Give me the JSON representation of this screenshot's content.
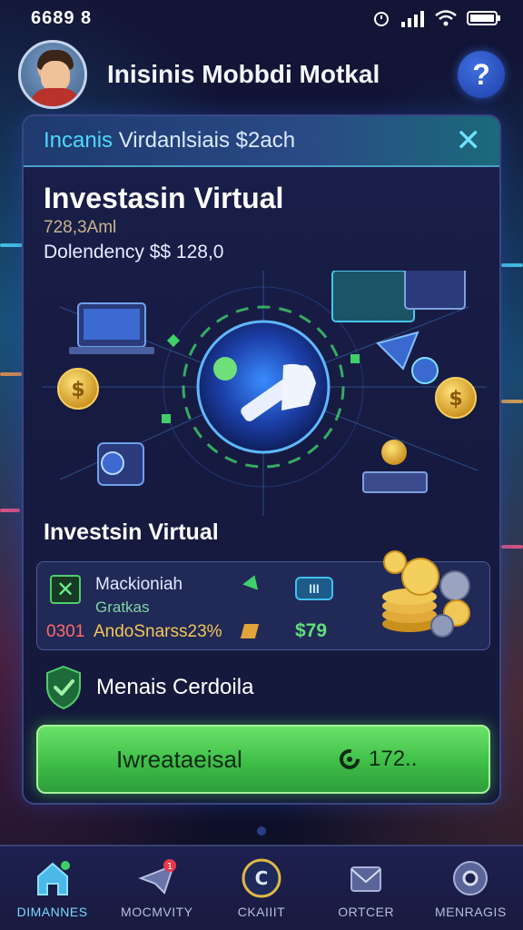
{
  "status_bar": {
    "time": "6689 8"
  },
  "header": {
    "title": "Inisinis Mobbdi Motkal",
    "help": "?"
  },
  "banner": {
    "prefix": "Incanis",
    "text": " Virdanlsiais $2ach",
    "close": "✕"
  },
  "card": {
    "title": "Investasin Virtual",
    "code": "728,3Aml",
    "dependency": "Dolendency $$ 128,0"
  },
  "section": {
    "title": "Investsin Virtual"
  },
  "stats": {
    "name": "Mackioniah",
    "sub": "Gratkas",
    "code": "0301",
    "desc": "AndoSnarss23%",
    "pill": "III",
    "amount": "$79"
  },
  "certificate": {
    "label": "Menais Cerdoila"
  },
  "invest_button": {
    "label": "Iwreataeisal",
    "amount": "172.."
  },
  "nav": {
    "items": [
      {
        "label": "DIMANNES",
        "icon": "home-icon"
      },
      {
        "label": "MOCMVITY",
        "icon": "send-icon"
      },
      {
        "label": "CKAIIIT",
        "icon": "coin-icon"
      },
      {
        "label": "ORTCER",
        "icon": "mail-icon"
      },
      {
        "label": "MENRAGIS",
        "icon": "gear-icon"
      }
    ]
  },
  "colors": {
    "accent": "#4fd8ff",
    "cta": "#3fbe48",
    "brand": "#1d3fa8"
  }
}
